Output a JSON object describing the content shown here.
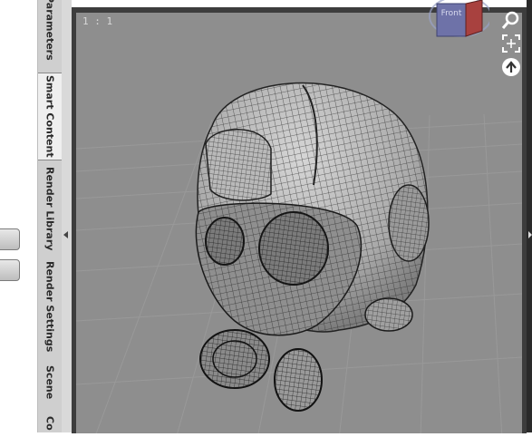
{
  "tabs": [
    {
      "label": "Parameters",
      "active": false
    },
    {
      "label": "Smart Content",
      "active": true
    },
    {
      "label": "Render Library",
      "active": false
    },
    {
      "label": "Render Settings",
      "active": false
    },
    {
      "label": "Scene",
      "active": false
    },
    {
      "label": "Co",
      "active": false
    }
  ],
  "viewport": {
    "aspect_label": "1 : 1",
    "cube_face_label": "Front"
  },
  "icons": [
    "search-icon",
    "frame-icon",
    "home-icon"
  ],
  "colors": {
    "viewport_bg": "#8e8e8e",
    "tab_strip": "#cfcfcf",
    "active_tab": "#efefef"
  }
}
